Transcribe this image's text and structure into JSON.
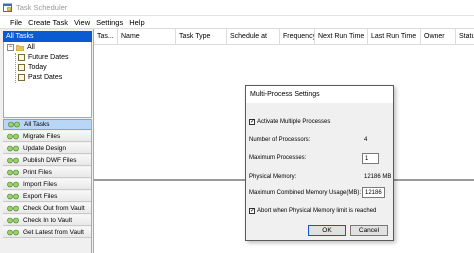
{
  "window": {
    "title": "Task Scheduler"
  },
  "menu": [
    "File",
    "Create Task",
    "View",
    "Settings",
    "Help"
  ],
  "tree": {
    "header": "All Tasks",
    "root": {
      "toggle": "−",
      "label": "All"
    },
    "children": [
      "Future Dates",
      "Today",
      "Past Dates"
    ]
  },
  "tasks": {
    "items": [
      "All Tasks",
      "Migrate Files",
      "Update Design",
      "Publish DWF Files",
      "Print Files",
      "Import Files",
      "Export Files",
      "Check Out from Vault",
      "Check In to Vault",
      "Get Latest from Vault"
    ]
  },
  "grid": {
    "columns": [
      "Tas...",
      "Name",
      "Task Type",
      "Schedule at",
      "Frequency",
      "Next Run Time",
      "Last Run Time",
      "Owner",
      "Statu"
    ]
  },
  "dialog": {
    "title": "Multi-Process Settings",
    "activate_label": "Activate Multiple Processes",
    "activate_checked": "✓",
    "processors_label": "Number of Processors:",
    "processors_value": "4",
    "max_proc_label": "Maximum Processes:",
    "max_proc_value": "1",
    "phys_mem_label": "Physical Memory:",
    "phys_mem_value": "12186 MB",
    "max_mem_label": "Maximum Combined Memory Usage(MB):",
    "max_mem_value": "12186",
    "abort_label": "Abort when Physical Memory limit is reached",
    "abort_checked": "✓",
    "ok_label": "OK",
    "cancel_label": "Cancel"
  }
}
